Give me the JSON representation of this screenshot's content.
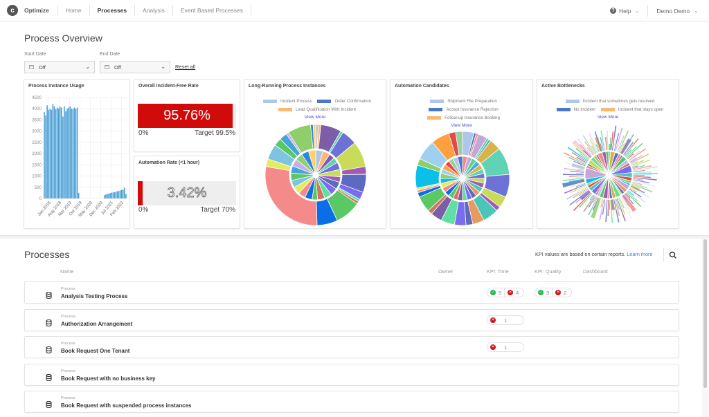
{
  "header": {
    "brand": "Optimize",
    "nav": [
      {
        "label": "Home",
        "active": false
      },
      {
        "label": "Processes",
        "active": true
      },
      {
        "label": "Analysis",
        "active": false
      },
      {
        "label": "Event Based Processes",
        "active": false
      }
    ],
    "help_label": "Help",
    "user_label": "Demo Demo",
    "icons": {
      "logo": "camunda-logo-icon",
      "help": "question-circle-icon",
      "chevron": "chevron-down-icon"
    }
  },
  "overview": {
    "title": "Process Overview",
    "start_date": {
      "label": "Start Date",
      "value": "Off"
    },
    "end_date": {
      "label": "End Date",
      "value": "Off"
    },
    "reset_label": "Reset all"
  },
  "cards": {
    "usage": {
      "title": "Process Instance Usage"
    },
    "incident_free": {
      "title": "Overall Incident-Free Rate",
      "value_text": "95.76%",
      "value": 95.76,
      "min_label": "0%",
      "target_label": "Target 99.5%",
      "target": 99.5,
      "fill_color": "#d10a0a"
    },
    "automation_rate": {
      "title": "Automation Rate (<1 hour)",
      "value_text": "3.42%",
      "value": 3.42,
      "min_label": "0%",
      "target_label": "Target 70%",
      "target": 70,
      "fill_color": "#d10a0a"
    },
    "long_running": {
      "title": "Long-Running Process Instances",
      "legend": [
        {
          "label": "Incident Process",
          "color": "#aec7e8"
        },
        {
          "label": "Order Confirmation",
          "color": "#4a78c8"
        },
        {
          "label": "Lead Qualification With Incident",
          "color": "#fdb974"
        }
      ],
      "view_more": "View More"
    },
    "automation_candidates": {
      "title": "Automation Candidates",
      "legend": [
        {
          "label": "Shipment File Preparation",
          "color": "#aec7e8"
        },
        {
          "label": "Accept Insurance Rejection",
          "color": "#4a78c8"
        },
        {
          "label": "Follow-up Insurance Booking",
          "color": "#fdb974"
        }
      ],
      "view_more": "View More"
    },
    "bottlenecks": {
      "title": "Active Bottlenecks",
      "legend": [
        {
          "label": "Incident that sometimes gets resolved",
          "color": "#aec7e8"
        },
        {
          "label": "No Incident",
          "color": "#4a78c8"
        },
        {
          "label": "Incident that stays open",
          "color": "#fdb974"
        }
      ],
      "view_more": "View More"
    }
  },
  "chart_data": [
    {
      "type": "bar",
      "title": "Process Instance Usage",
      "xlabel": "",
      "ylabel": "",
      "ylim": [
        0,
        4500
      ],
      "yticks": [
        0,
        500,
        1000,
        1500,
        2000,
        2500,
        3000,
        3500,
        4000,
        4500
      ],
      "xtick_labels": [
        "Jan 2018",
        "Aug 2018",
        "Mar 2019",
        "Oct 2019",
        "May 2020",
        "Dec 2020",
        "Jul 2021",
        "Feb 2022"
      ],
      "grid": true,
      "color": "#4a9fd4",
      "values": [
        3850,
        3700,
        4150,
        3950,
        4000,
        3950,
        4200,
        4100,
        3980,
        4050,
        4000,
        4100,
        4050,
        3650,
        4100,
        3880,
        4000,
        4050,
        4100,
        4000,
        3980,
        4050,
        4000,
        4050,
        250,
        0,
        0,
        0,
        0,
        0,
        0,
        0,
        0,
        0,
        0,
        0,
        0,
        0,
        0,
        0,
        0,
        0,
        150,
        180,
        200,
        220,
        240,
        260,
        270,
        280,
        300,
        320,
        340,
        360,
        380,
        400,
        480,
        200
      ]
    },
    {
      "type": "pie",
      "title": "Long-Running Process Instances",
      "variant": "sunburst-two-ring",
      "legend": [
        "Incident Process",
        "Order Confirmation",
        "Lead Qualification With Incident"
      ],
      "inner": [
        4,
        4,
        3,
        3,
        4,
        4,
        3,
        4,
        4,
        4,
        4,
        3,
        4,
        4,
        4,
        4,
        4,
        4,
        4,
        4,
        4,
        4
      ],
      "outer": [
        1,
        1,
        8,
        1,
        6,
        10,
        3,
        7,
        3,
        1,
        1,
        10,
        8,
        34,
        3,
        6,
        3,
        3,
        1,
        9,
        1,
        1
      ],
      "colors": [
        "#aec7e8",
        "#fdb974",
        "#7b5ea7",
        "#5fd3b3",
        "#6e72d6",
        "#c8dc5a",
        "#a05bb4",
        "#5c6bc0",
        "#7a6cf0",
        "#5fe0a0",
        "#d4735e",
        "#5ac864",
        "#0a6ee8",
        "#f58a8a",
        "#e4ec5c",
        "#7ec4e0",
        "#5ac864",
        "#4aa3d8",
        "#c4b0e8",
        "#8ecf6c",
        "#2e86de",
        "#ffd166"
      ]
    },
    {
      "type": "pie",
      "title": "Automation Candidates",
      "variant": "sunburst-two-ring",
      "legend": [
        "Shipment File Preparation",
        "Accept Insurance Rejection",
        "Follow-up Insurance Booking"
      ],
      "inner": [
        3,
        3,
        3,
        3,
        3,
        3,
        3,
        3,
        3,
        3,
        3,
        3,
        3,
        3,
        3,
        3,
        3,
        3,
        3,
        3,
        3,
        3,
        3,
        3,
        3,
        3,
        3,
        3
      ],
      "outer": [
        5,
        1,
        1,
        4,
        1,
        1,
        5,
        12,
        10,
        5,
        2,
        7,
        5,
        3,
        5,
        6,
        5,
        2,
        7,
        2,
        1,
        1,
        10,
        3,
        9,
        8,
        3,
        3
      ],
      "colors": [
        "#aec7e8",
        "#4a78c8",
        "#f58a8a",
        "#c4a6d8",
        "#5fd38a",
        "#4aaed6",
        "#d9b24a",
        "#5fd3b3",
        "#6e72d6",
        "#c8dc5a",
        "#a05bb4",
        "#4ac6b8",
        "#e89a5e",
        "#5c6bc0",
        "#7a6cf0",
        "#5fe0a0",
        "#7b5ea7",
        "#d4735e",
        "#5ac864",
        "#0a6ee8",
        "#f58a8a",
        "#e4ec5c",
        "#0bc0e8",
        "#8ecf6c",
        "#a0d0f0",
        "#ff9f40",
        "#e24a4a",
        "#9ad0a0"
      ]
    },
    {
      "type": "pie",
      "title": "Active Bottlenecks",
      "variant": "sunburst-multi-slice",
      "legend": [
        "Incident that sometimes gets resolved",
        "No Incident",
        "Incident that stays open"
      ],
      "inner_slices": 40,
      "outer_slices": 140
    }
  ],
  "processes": {
    "title": "Processes",
    "kpi_note": "KPI values are based on certain reports.",
    "learn_more": "Learn more",
    "columns": [
      "Name",
      "Owner",
      "KPI: Time",
      "KPI: Quality",
      "Dashboard"
    ],
    "rows": [
      {
        "kind": "Process",
        "name": "Analysis Testing Process",
        "kpi_time": {
          "ok": 5,
          "bad": 4
        },
        "kpi_quality": {
          "ok": 3,
          "bad": 2
        }
      },
      {
        "kind": "Process",
        "name": "Authorization Arrangement",
        "kpi_time": {
          "bad": 1
        },
        "kpi_quality": null
      },
      {
        "kind": "Process",
        "name": "Book Request One Tenant",
        "kpi_time": {
          "bad": 1
        },
        "kpi_quality": null
      },
      {
        "kind": "Process",
        "name": "Book Request with no business key",
        "kpi_time": null,
        "kpi_quality": null
      },
      {
        "kind": "Process",
        "name": "Book Request with suspended process instances",
        "kpi_time": null,
        "kpi_quality": null
      }
    ]
  }
}
